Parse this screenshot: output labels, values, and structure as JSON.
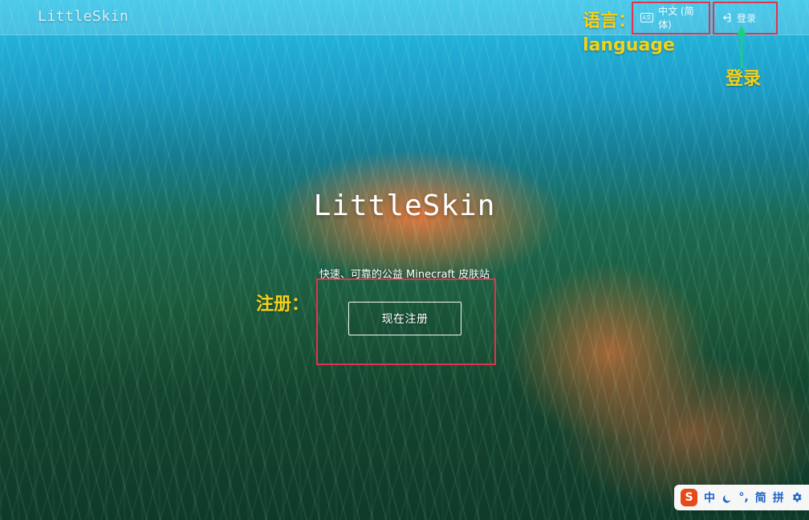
{
  "navbar": {
    "brand": "LittleSkin",
    "language_label": "中文 (简体)",
    "login_label": "登录"
  },
  "hero": {
    "title": "LittleSkin",
    "subtitle": "快速、可靠的公益 Minecraft 皮肤站",
    "register_label": "现在注册"
  },
  "annotations": {
    "language_cn": "语言：",
    "language_en": "language",
    "login": "登录",
    "register": "注册："
  },
  "ime": {
    "logo": "S",
    "lang": "中",
    "punct": "°,",
    "simplified": "简",
    "pinyin": "拼"
  },
  "colors": {
    "annotation_box": "#e0334e",
    "annotation_text": "#f5d21a",
    "arrow": "#19d37a",
    "ime_logo": "#e64a19",
    "ime_text": "#1e63c7"
  },
  "icons": [
    "language-icon",
    "sign-in-icon",
    "moon-icon",
    "gear-icon"
  ]
}
